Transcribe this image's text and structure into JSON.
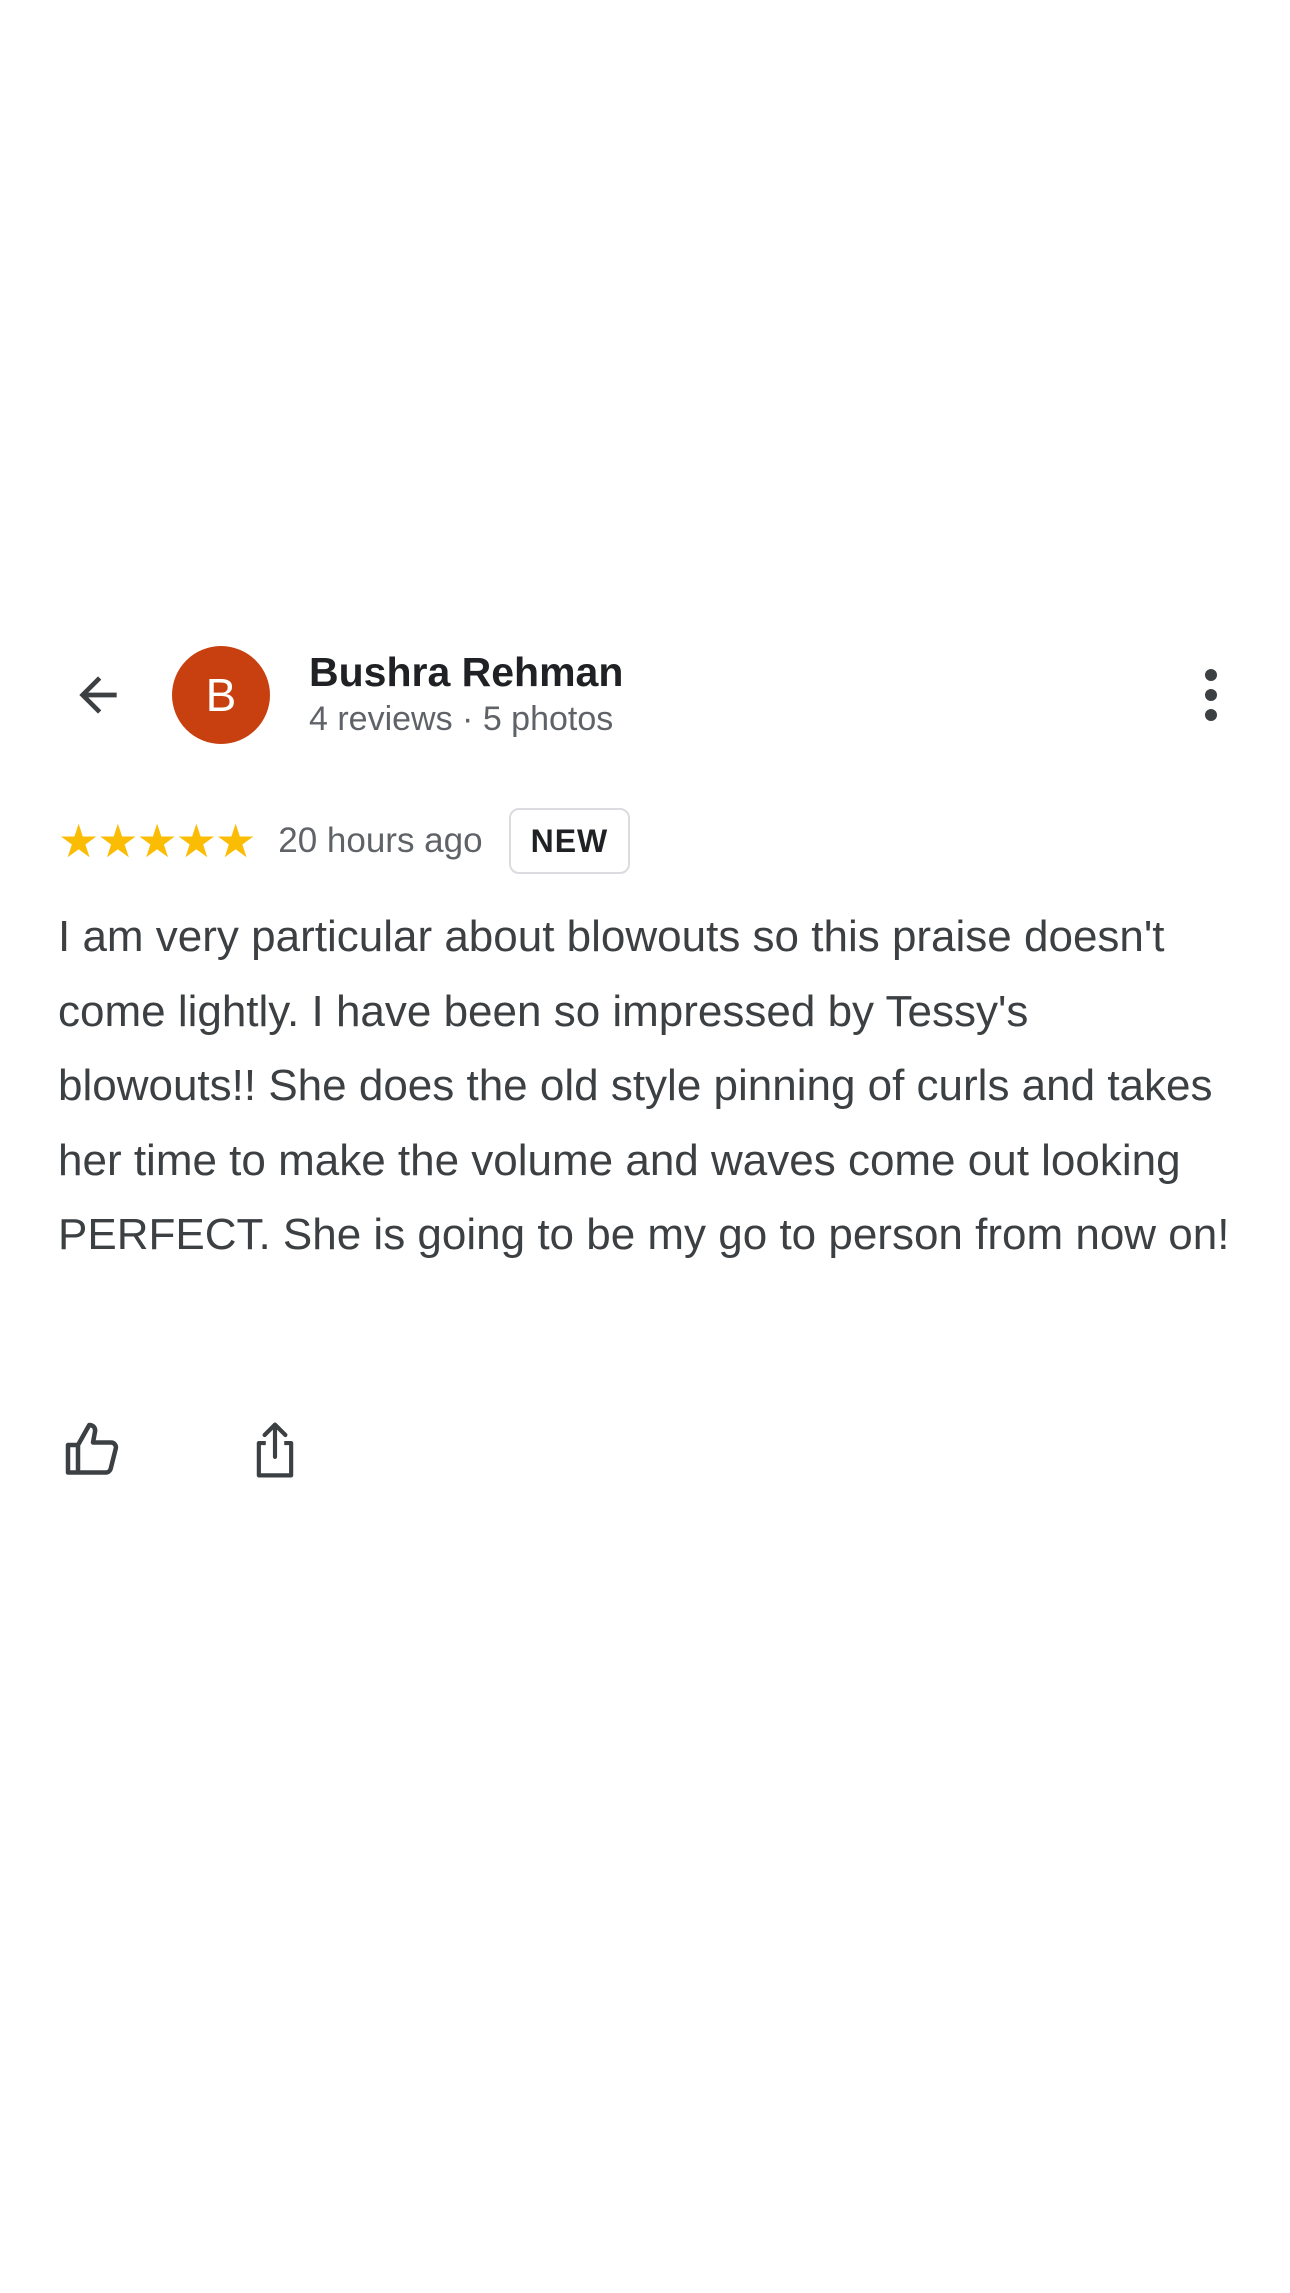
{
  "reviewer": {
    "avatar_letter": "B",
    "avatar_color": "#c8400f",
    "name": "Bushra Rehman",
    "meta": "4 reviews · 5 photos"
  },
  "rating": {
    "stars": 5,
    "max_stars": 5,
    "star_color": "#fbbc04",
    "time": "20 hours ago",
    "badge": "NEW"
  },
  "review": {
    "text": "I am very particular about blowouts so this praise doesn't come lightly. I have been so impressed by Tessy's blowouts!! She does the old style pinning of curls and takes her time to make the volume and waves come out looking PERFECT. She is going to be my go to person from now on!"
  },
  "icons": {
    "back": "arrow-back-icon",
    "more": "more-vert-icon",
    "like": "thumb-up-icon",
    "share": "share-icon"
  }
}
